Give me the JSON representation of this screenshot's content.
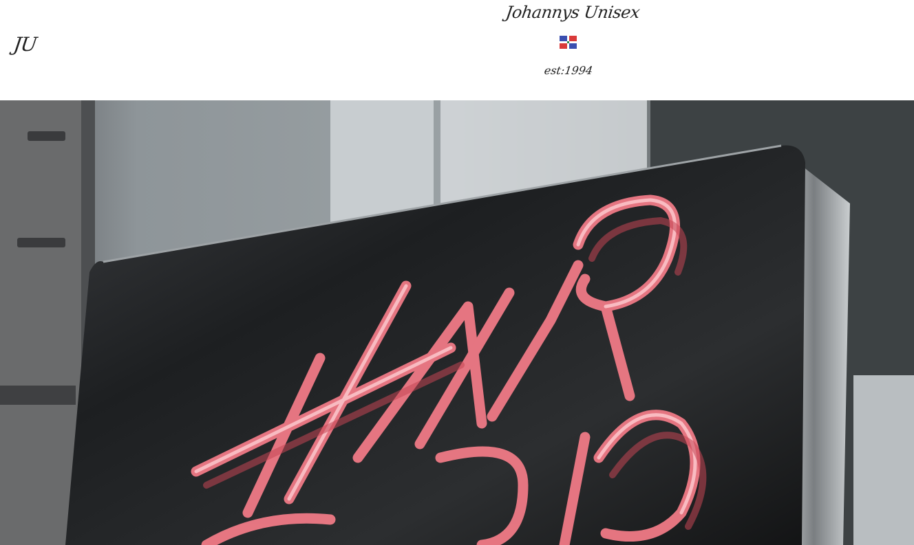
{
  "header": {
    "logo_text": "JU",
    "brand_name": "Johannys Unisex",
    "established": "est:1994",
    "flag_icon": "dominican-republic-flag-icon"
  },
  "hero": {
    "image_subject": "neon-hair-sign-photo",
    "neon_color": "#f07a86",
    "sign_color": "#1c1d1f"
  }
}
